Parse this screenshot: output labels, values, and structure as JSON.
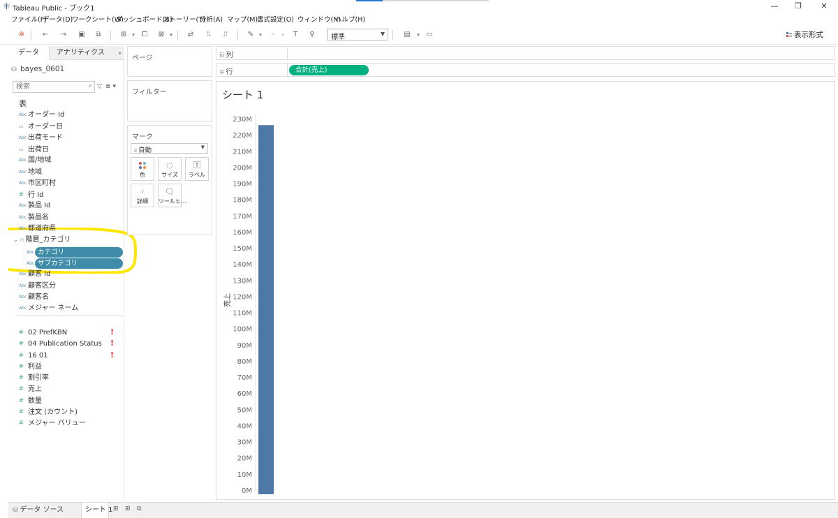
{
  "window": {
    "title": "Tableau Public - ブック1",
    "controls": {
      "minimize": "—",
      "restore": "❐",
      "close": "✕"
    }
  },
  "menu": [
    "ファイル(F)",
    "データ(D)",
    "ワークシート(W)",
    "ダッシュボード(B)",
    "ストーリー(T)",
    "分析(A)",
    "マップ(M)",
    "書式設定(O)",
    "ウィンドウ(N)",
    "ヘルプ(H)"
  ],
  "toolbar": {
    "fit_value": "標準",
    "show_me": "表示形式"
  },
  "left_pane": {
    "tab_data": "データ",
    "tab_analytics": "アナリティクス",
    "datasource": "bayes_0601",
    "search_placeholder": "検索",
    "section_table": "表",
    "dimensions": [
      {
        "label": "オーダー Id",
        "type": "Abc"
      },
      {
        "label": "オーダー日",
        "type": "date"
      },
      {
        "label": "出荷モード",
        "type": "Abc"
      },
      {
        "label": "出荷日",
        "type": "date"
      },
      {
        "label": "国/地域",
        "type": "Abc"
      },
      {
        "label": "地域",
        "type": "Abc"
      },
      {
        "label": "市区町村",
        "type": "Abc"
      },
      {
        "label": "行 Id",
        "type": "#"
      },
      {
        "label": "製品 Id",
        "type": "Abc"
      },
      {
        "label": "製品名",
        "type": "Abc"
      },
      {
        "label": "都道府県",
        "type": "Abc"
      }
    ],
    "hierarchy": {
      "label": "階層_カテゴリ",
      "children": [
        "カテゴリ",
        "サブカテゴリ"
      ]
    },
    "dimensions_after": [
      {
        "label": "顧客 Id",
        "type": "Abc"
      },
      {
        "label": "顧客区分",
        "type": "Abc"
      },
      {
        "label": "顧客名",
        "type": "Abc"
      },
      {
        "label": "メジャー ネーム",
        "type": "Abc"
      }
    ],
    "measures": [
      {
        "label": "02 PrefKBN",
        "type": "#",
        "warning": "!"
      },
      {
        "label": "04 Publication Status",
        "type": "#",
        "warning": "!"
      },
      {
        "label": "16 01",
        "type": "#",
        "warning": "!"
      },
      {
        "label": "利益",
        "type": "#"
      },
      {
        "label": "割引率",
        "type": "#"
      },
      {
        "label": "売上",
        "type": "#"
      },
      {
        "label": "数量",
        "type": "#"
      },
      {
        "label": "注文 (カウント)",
        "type": "#"
      },
      {
        "label": "メジャー バリュー",
        "type": "#"
      }
    ]
  },
  "cards": {
    "pages": "ページ",
    "filters": "フィルター",
    "marks": "マーク",
    "marks_type": "自動",
    "mark_buttons": [
      "色",
      "サイズ",
      "ラベル",
      "詳細",
      "ツールヒ…"
    ]
  },
  "shelves": {
    "columns": "列",
    "rows": "行",
    "rows_pill": "合計(売上)"
  },
  "sheet": {
    "title": "シート 1"
  },
  "chart_data": {
    "type": "bar",
    "categories": [
      ""
    ],
    "values": [
      226
    ],
    "ylabel": "売上",
    "ylim": [
      0,
      230
    ],
    "yticks": [
      "0M",
      "10M",
      "20M",
      "30M",
      "40M",
      "50M",
      "60M",
      "70M",
      "80M",
      "90M",
      "100M",
      "110M",
      "120M",
      "130M",
      "140M",
      "150M",
      "160M",
      "170M",
      "180M",
      "190M",
      "200M",
      "210M",
      "220M",
      "230M"
    ],
    "bar_color": "#4e79a7",
    "grid": false
  },
  "bottom_tabs": {
    "datasource": "データ ソース",
    "sheet1": "シート 1"
  },
  "colors": {
    "rows_pill": "#00b17f",
    "dimension_pill": "#3f8ca8",
    "highlight": "#ffe600",
    "warning": "#e03030"
  }
}
